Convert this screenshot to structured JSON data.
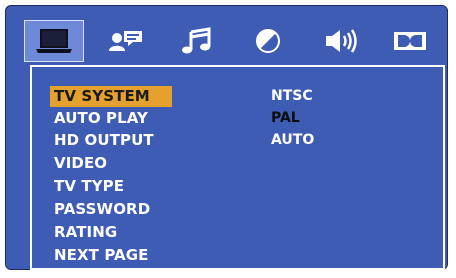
{
  "tabs": [
    {
      "icon": "system-setup-icon",
      "selected": true
    },
    {
      "icon": "language-setup-icon",
      "selected": false
    },
    {
      "icon": "audio-setup-icon",
      "selected": false
    },
    {
      "icon": "video-setup-icon",
      "selected": false
    },
    {
      "icon": "speaker-setup-icon",
      "selected": false
    },
    {
      "icon": "dolby-digital-setup-icon",
      "selected": false
    }
  ],
  "menu": {
    "items": [
      {
        "label": "TV SYSTEM",
        "selected": true
      },
      {
        "label": "AUTO PLAY",
        "selected": false
      },
      {
        "label": "HD OUTPUT",
        "selected": false
      },
      {
        "label": "VIDEO",
        "selected": false
      },
      {
        "label": "TV TYPE",
        "selected": false
      },
      {
        "label": "PASSWORD",
        "selected": false
      },
      {
        "label": "RATING",
        "selected": false
      },
      {
        "label": "NEXT PAGE",
        "selected": false
      }
    ],
    "options": [
      {
        "label": "NTSC",
        "current": false
      },
      {
        "label": "PAL",
        "current": true
      },
      {
        "label": "AUTO",
        "current": false
      }
    ]
  },
  "colors": {
    "frame": "#3f5cb4",
    "tab_selected": "#6d89d8",
    "item_highlight": "#e5a12e",
    "text": "#ffffff",
    "current_option_text": "#0d0d0d"
  }
}
